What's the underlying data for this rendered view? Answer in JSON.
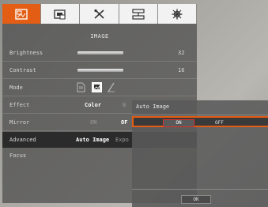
{
  "tabs": [
    {
      "icon": "image-settings-icon"
    },
    {
      "icon": "display-settings-icon"
    },
    {
      "icon": "tools-icon"
    },
    {
      "icon": "network-icon"
    },
    {
      "icon": "system-settings-icon"
    }
  ],
  "menu": {
    "title": "IMAGE",
    "brightness": {
      "label": "Brightness",
      "value": "32",
      "level": 0.5
    },
    "contrast": {
      "label": "Contrast",
      "value": "16",
      "level": 0.5
    },
    "mode": {
      "label": "Mode",
      "icons": [
        "document-mode-icon",
        "photo-mode-icon",
        "pen-mode-icon"
      ]
    },
    "effect": {
      "label": "Effect",
      "current": "Color",
      "next": "B"
    },
    "mirror": {
      "label": "Mirror",
      "off_option": "ON",
      "on_option": "OF"
    },
    "advanced": {
      "label": "Advanced",
      "current": "Auto Image",
      "next": "Expo"
    },
    "focus": {
      "label": "Focus"
    }
  },
  "dialog": {
    "title": "Auto Image",
    "on_label": "ON",
    "off_label": "OFF",
    "ok_label": "OK"
  },
  "colors": {
    "accent": "#e35d14",
    "highlight_border": "#d9322b"
  }
}
